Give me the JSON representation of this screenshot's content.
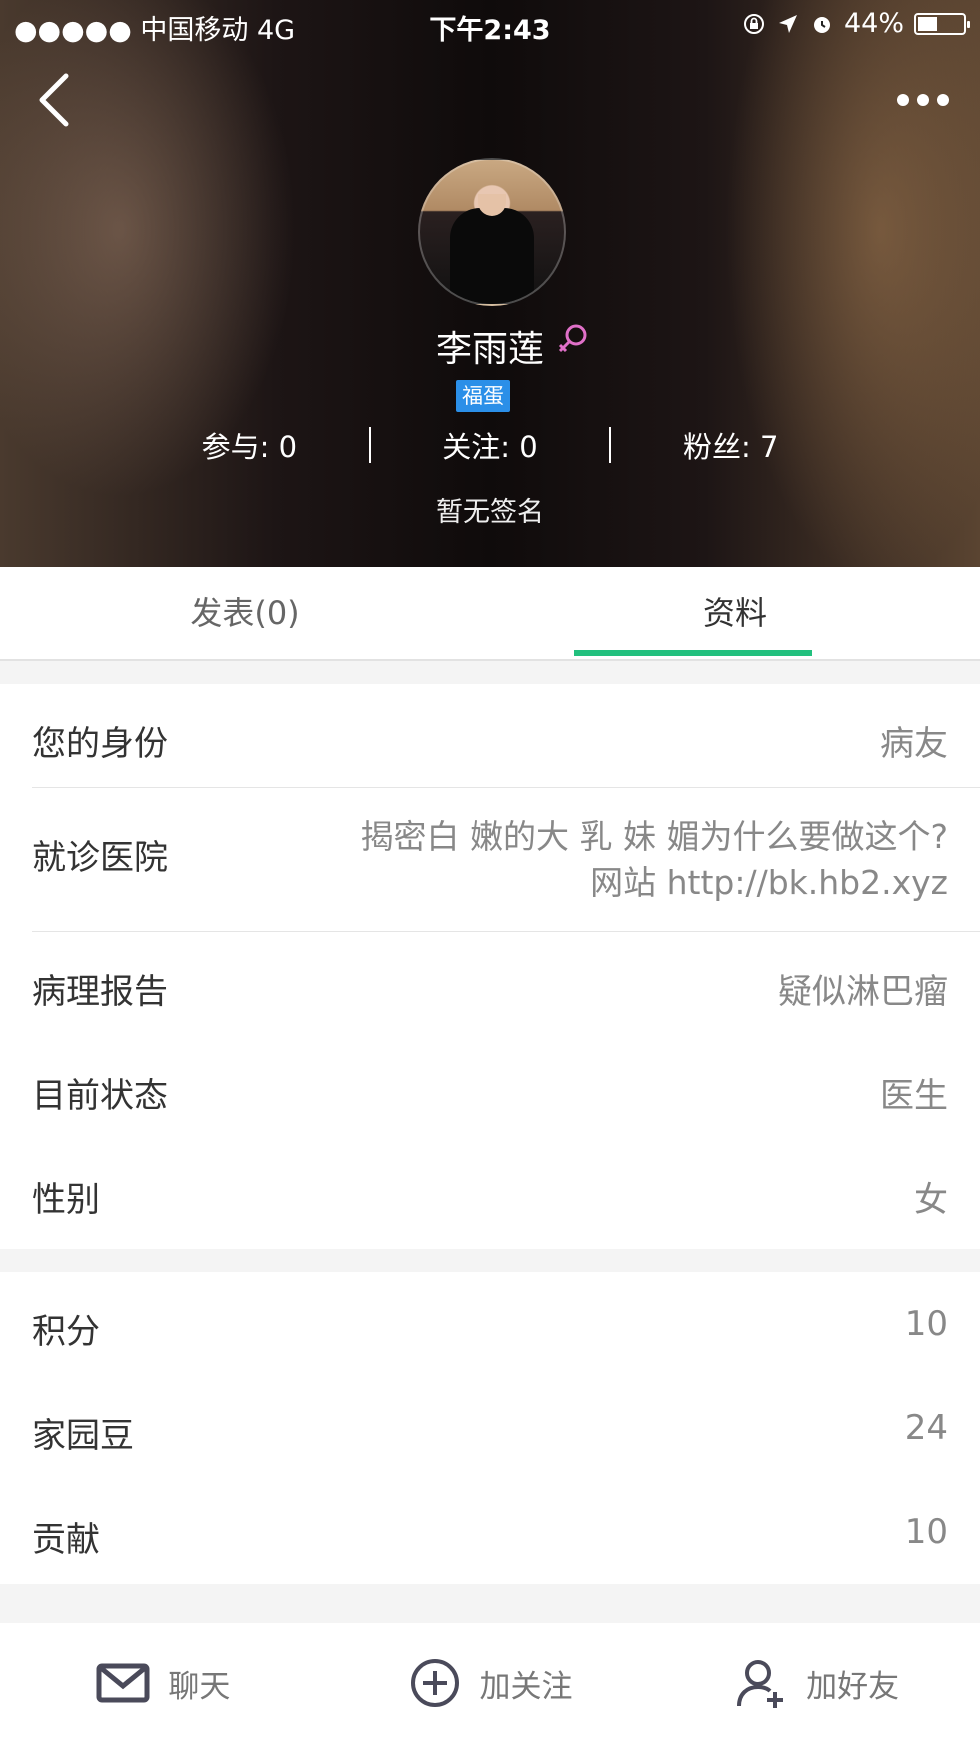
{
  "status_bar": {
    "carrier": "●●●●● 中国移动   4G",
    "time": "下午2:43",
    "battery": "44%",
    "battery_level": 0.44
  },
  "profile": {
    "name": "李雨莲",
    "gender_icon": "female-icon",
    "badge": "福蛋",
    "stats": {
      "participate": "参与: 0",
      "following": "关注: 0",
      "fans": "粉丝: 7"
    },
    "signature": "暂无签名"
  },
  "tabs": [
    {
      "label": "发表(0)"
    },
    {
      "label": "资料"
    }
  ],
  "info_section_1": [
    {
      "label": "您的身份",
      "value": "病友"
    },
    {
      "label": "就诊医院",
      "value_line1": "揭密白 嫩的大 乳 妹 媚为什么要做这个?",
      "value_line2": "网站 http://bk.hb2.xyz"
    },
    {
      "label": "病理报告",
      "value": "疑似淋巴瘤"
    },
    {
      "label": "目前状态",
      "value": "医生"
    },
    {
      "label": "性别",
      "value": "女"
    }
  ],
  "info_section_2": [
    {
      "label": "积分",
      "value": "10"
    },
    {
      "label": "家园豆",
      "value": "24"
    },
    {
      "label": "贡献",
      "value": "10"
    }
  ],
  "bottom_actions": [
    {
      "label": "聊天",
      "icon": "mail-icon"
    },
    {
      "label": "加关注",
      "icon": "plus-circle-icon"
    },
    {
      "label": "加好友",
      "icon": "add-user-icon"
    }
  ],
  "colors": {
    "accent": "#22c07e",
    "badge": "#2b8fe8",
    "female": "#e070c8"
  }
}
